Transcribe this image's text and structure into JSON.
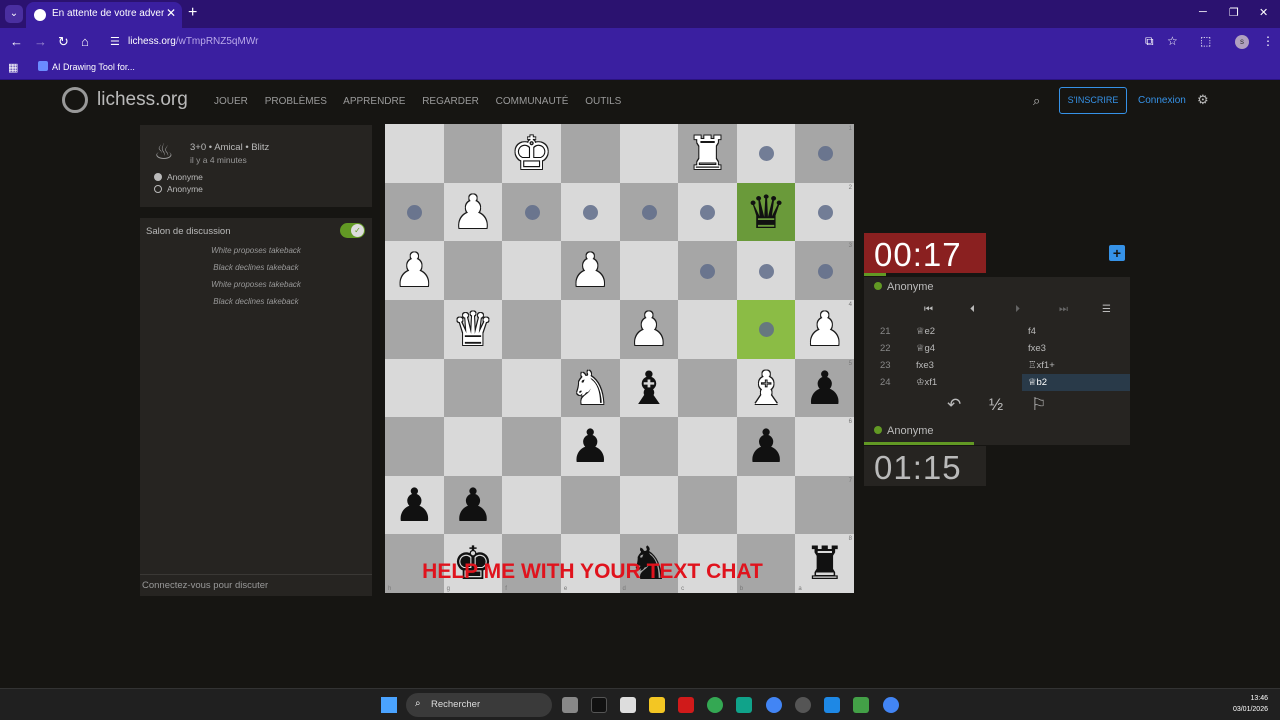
{
  "browser": {
    "tab_title": "En attente de votre adversaire",
    "url_domain": "lichess.org",
    "url_path": "/wTmpRNZ5qMWr",
    "bookmark": "AI Drawing Tool for..."
  },
  "header": {
    "logo": "lichess.org",
    "nav": [
      "JOUER",
      "PROBLÈMES",
      "APPRENDRE",
      "REGARDER",
      "COMMUNAUTÉ",
      "OUTILS"
    ],
    "signup": "S'INSCRIRE",
    "login": "Connexion"
  },
  "game": {
    "type": "3+0 • Amical • Blitz",
    "time_ago": "il y a 4 minutes",
    "player_white": "Anonyme",
    "player_black": "Anonyme"
  },
  "chat": {
    "title": "Salon de discussion",
    "messages": [
      "White proposes takeback",
      "Black declines takeback",
      "White proposes takeback",
      "Black declines takeback"
    ],
    "input_placeholder": "Connectez-vous pour discuter"
  },
  "board": {
    "overlay_text": "HELP ME WITH YOUR TEXT CHAT",
    "ranks": [
      "1",
      "2",
      "3",
      "4",
      "5",
      "6",
      "7",
      "8"
    ],
    "files": [
      "h",
      "g",
      "f",
      "e",
      "d",
      "c",
      "b",
      "a"
    ]
  },
  "clocks": {
    "top": "00:17",
    "bottom": "01:15",
    "top_player": "Anonyme",
    "bottom_player": "Anonyme"
  },
  "moves": [
    {
      "num": "21",
      "white": "♕e2",
      "black": "f4"
    },
    {
      "num": "22",
      "white": "♕g4",
      "black": "fxe3"
    },
    {
      "num": "23",
      "white": "fxe3",
      "black": "♖xf1+"
    },
    {
      "num": "24",
      "white": "♔xf1",
      "black": "♕b2"
    }
  ],
  "controls": {
    "draw": "½"
  },
  "taskbar": {
    "search": "Rechercher",
    "time": "13:46",
    "date": "03/01/2026"
  }
}
